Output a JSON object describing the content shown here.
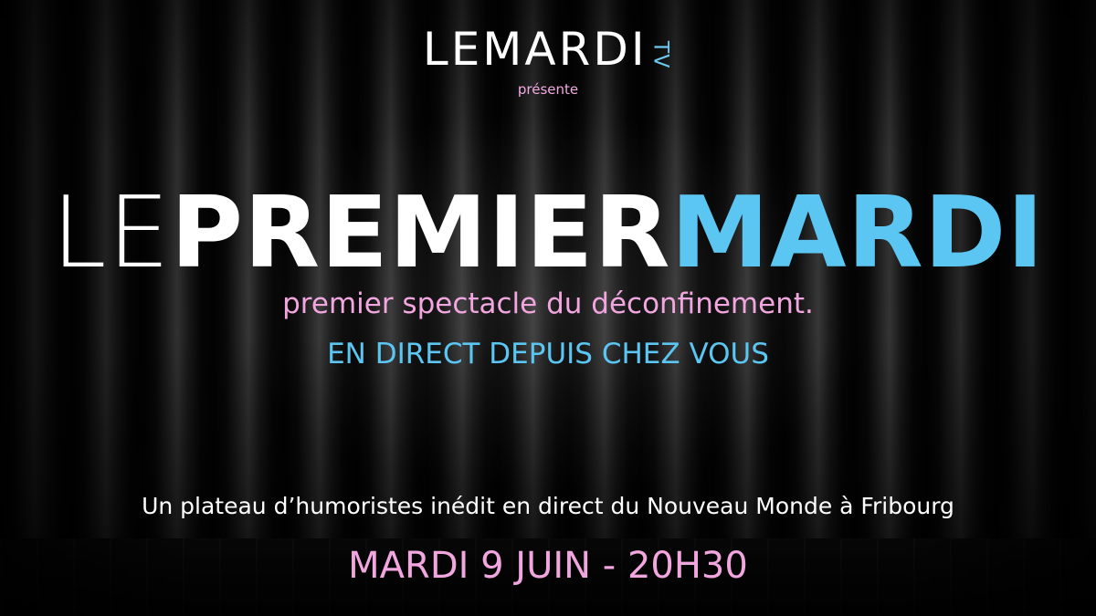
{
  "logo": {
    "le": "LE",
    "mardi": "MARDI",
    "tv": "TV"
  },
  "presente": "présente",
  "title": {
    "le": "LE",
    "premier": "PREMIER",
    "mardi": "MARDI"
  },
  "subtitle": "premier spectacle du déconfinement.",
  "direct": "EN DIRECT DEPUIS CHEZ VOUS",
  "plateau": "Un plateau d’humoristes inédit en direct du Nouveau Monde à Fribourg",
  "date": "MARDI 9 JUIN - 20H30",
  "colors": {
    "accent_blue": "#5cc6f2",
    "accent_pink": "#f2a6df",
    "text_white": "#ffffff",
    "background": "#050505"
  }
}
